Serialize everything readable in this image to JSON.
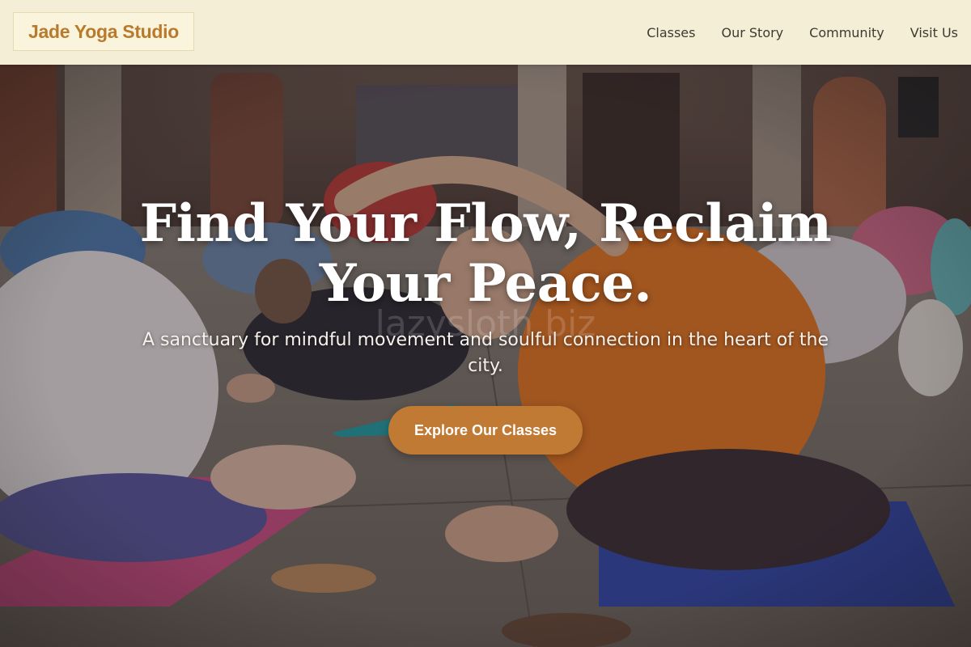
{
  "header": {
    "logo": "Jade Yoga Studio",
    "nav": [
      {
        "label": "Classes"
      },
      {
        "label": "Our Story"
      },
      {
        "label": "Community"
      },
      {
        "label": "Visit Us"
      }
    ]
  },
  "hero": {
    "title": "Find Your Flow, Reclaim Your Peace.",
    "watermark": "lazysloth.biz",
    "subtitle": "A sanctuary for mindful movement and soulful connection in the heart of the city.",
    "cta_label": "Explore Our Classes",
    "image": "group yoga class stretching on mats"
  },
  "colors": {
    "header_bg": "#f4eed6",
    "logo_text": "#b87a2c",
    "cta_bg": "#c07a34",
    "hero_text": "#ffffff"
  }
}
